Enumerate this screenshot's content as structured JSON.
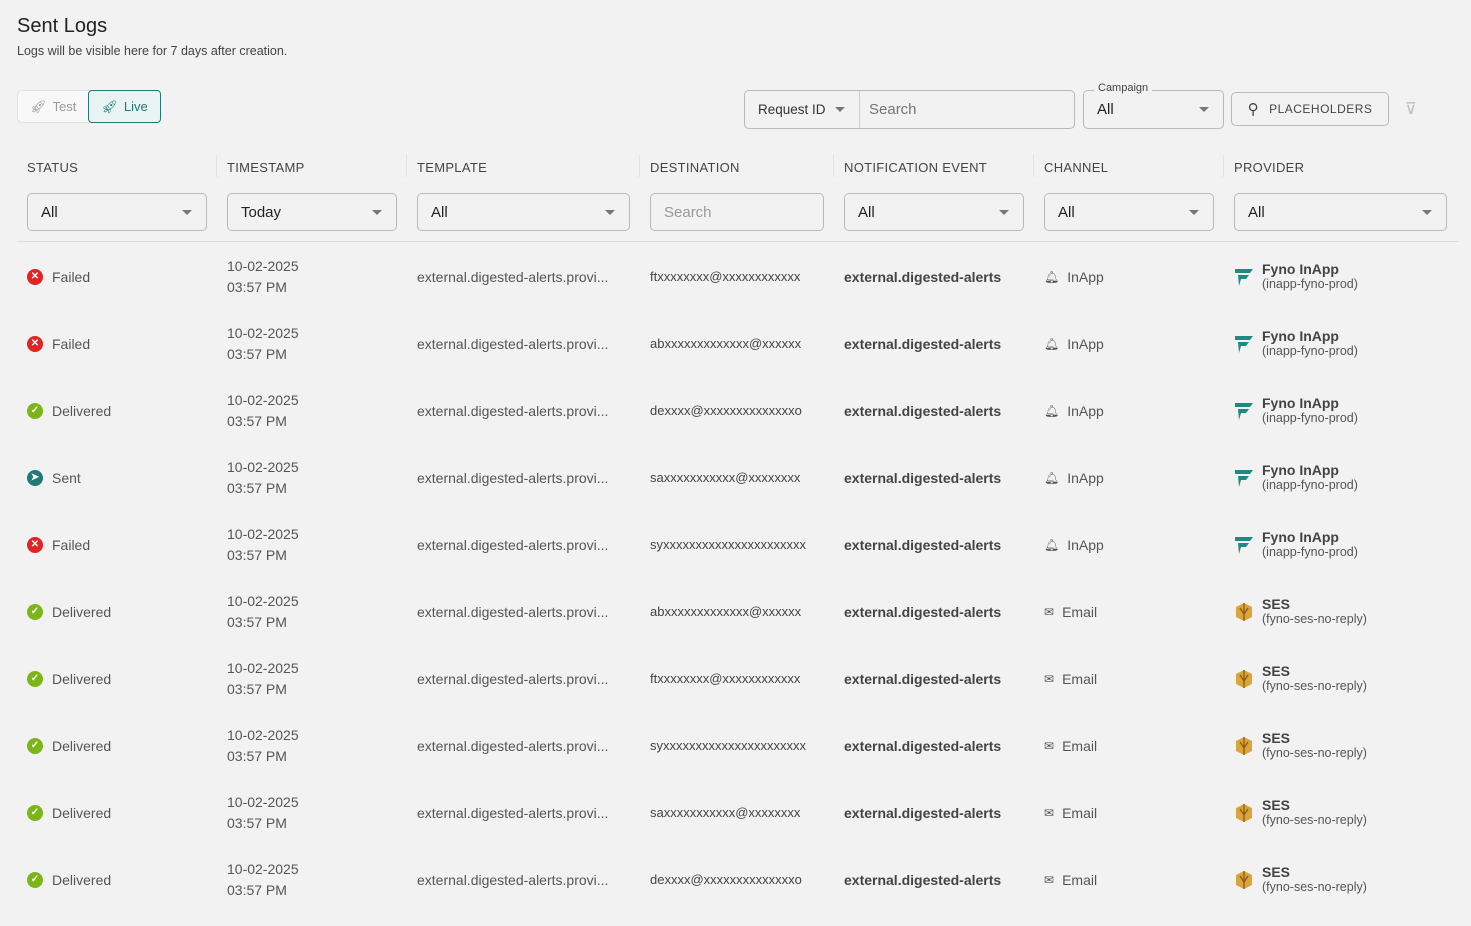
{
  "page": {
    "title": "Sent Logs",
    "subtitle": "Logs will be visible here for 7 days after creation."
  },
  "mode": {
    "test": "Test",
    "live": "Live",
    "active": "Live"
  },
  "toolbar": {
    "request_select": "Request ID",
    "search_placeholder": "Search",
    "campaign_label": "Campaign",
    "campaign_value": "All",
    "placeholders_button": "PLACEHOLDERS",
    "clear_filter_icon": "filter-off-icon"
  },
  "columns": [
    "STATUS",
    "TIMESTAMP",
    "TEMPLATE",
    "DESTINATION",
    "NOTIFICATION EVENT",
    "CHANNEL",
    "PROVIDER"
  ],
  "filters": {
    "status": "All",
    "timestamp": "Today",
    "template": "All",
    "destination_placeholder": "Search",
    "event": "All",
    "channel": "All",
    "provider": "All"
  },
  "colors": {
    "failed": "#e02424",
    "delivered": "#7cb518",
    "sent": "#1f7a78",
    "accent": "#1f7a78"
  },
  "rows": [
    {
      "status": "Failed",
      "date": "10-02-2025",
      "time": "03:57 PM",
      "template": "external.digested-alerts.provi...",
      "destination": "ftxxxxxxxx@xxxxxxxxxxxx",
      "event": "external.digested-alerts",
      "channel": "InApp",
      "provider": "Fyno InApp",
      "provider_id": "(inapp-fyno-prod)"
    },
    {
      "status": "Failed",
      "date": "10-02-2025",
      "time": "03:57 PM",
      "template": "external.digested-alerts.provi...",
      "destination": "abxxxxxxxxxxxxx@xxxxxx",
      "event": "external.digested-alerts",
      "channel": "InApp",
      "provider": "Fyno InApp",
      "provider_id": "(inapp-fyno-prod)"
    },
    {
      "status": "Delivered",
      "date": "10-02-2025",
      "time": "03:57 PM",
      "template": "external.digested-alerts.provi...",
      "destination": "dexxxx@xxxxxxxxxxxxxxo",
      "event": "external.digested-alerts",
      "channel": "InApp",
      "provider": "Fyno InApp",
      "provider_id": "(inapp-fyno-prod)"
    },
    {
      "status": "Sent",
      "date": "10-02-2025",
      "time": "03:57 PM",
      "template": "external.digested-alerts.provi...",
      "destination": "saxxxxxxxxxxx@xxxxxxxx",
      "event": "external.digested-alerts",
      "channel": "InApp",
      "provider": "Fyno InApp",
      "provider_id": "(inapp-fyno-prod)"
    },
    {
      "status": "Failed",
      "date": "10-02-2025",
      "time": "03:57 PM",
      "template": "external.digested-alerts.provi...",
      "destination": "syxxxxxxxxxxxxxxxxxxxxxx",
      "event": "external.digested-alerts",
      "channel": "InApp",
      "provider": "Fyno InApp",
      "provider_id": "(inapp-fyno-prod)"
    },
    {
      "status": "Delivered",
      "date": "10-02-2025",
      "time": "03:57 PM",
      "template": "external.digested-alerts.provi...",
      "destination": "abxxxxxxxxxxxxx@xxxxxx",
      "event": "external.digested-alerts",
      "channel": "Email",
      "provider": "SES",
      "provider_id": "(fyno-ses-no-reply)"
    },
    {
      "status": "Delivered",
      "date": "10-02-2025",
      "time": "03:57 PM",
      "template": "external.digested-alerts.provi...",
      "destination": "ftxxxxxxxx@xxxxxxxxxxxx",
      "event": "external.digested-alerts",
      "channel": "Email",
      "provider": "SES",
      "provider_id": "(fyno-ses-no-reply)"
    },
    {
      "status": "Delivered",
      "date": "10-02-2025",
      "time": "03:57 PM",
      "template": "external.digested-alerts.provi...",
      "destination": "syxxxxxxxxxxxxxxxxxxxxxx",
      "event": "external.digested-alerts",
      "channel": "Email",
      "provider": "SES",
      "provider_id": "(fyno-ses-no-reply)"
    },
    {
      "status": "Delivered",
      "date": "10-02-2025",
      "time": "03:57 PM",
      "template": "external.digested-alerts.provi...",
      "destination": "saxxxxxxxxxxx@xxxxxxxx",
      "event": "external.digested-alerts",
      "channel": "Email",
      "provider": "SES",
      "provider_id": "(fyno-ses-no-reply)"
    },
    {
      "status": "Delivered",
      "date": "10-02-2025",
      "time": "03:57 PM",
      "template": "external.digested-alerts.provi...",
      "destination": "dexxxx@xxxxxxxxxxxxxxo",
      "event": "external.digested-alerts",
      "channel": "Email",
      "provider": "SES",
      "provider_id": "(fyno-ses-no-reply)"
    }
  ]
}
